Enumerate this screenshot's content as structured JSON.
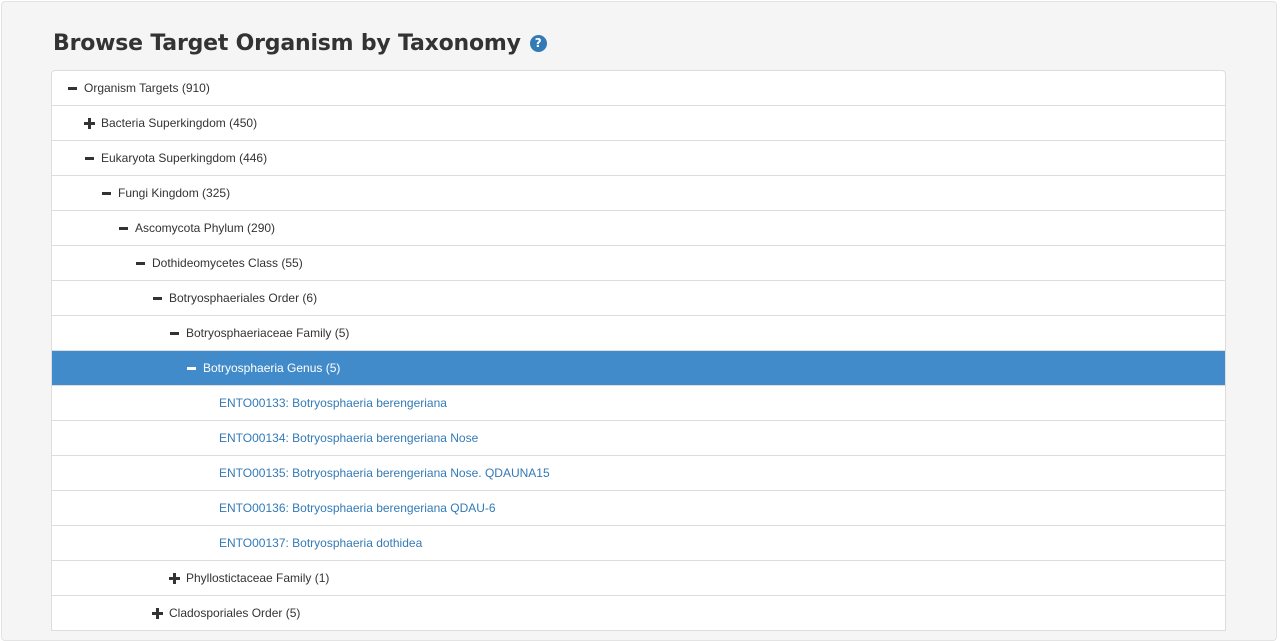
{
  "page": {
    "title": "Browse Target Organism by Taxonomy",
    "help_icon": "question-circle-icon"
  },
  "colors": {
    "selected_bg": "#428bca",
    "link": "#337ab7",
    "help_icon": "#337ab7"
  },
  "tree": {
    "rows": [
      {
        "label": "Organism Targets (910)",
        "toggle": "minus-icon"
      },
      {
        "label": "Bacteria Superkingdom (450)",
        "toggle": "plus-icon"
      },
      {
        "label": "Eukaryota Superkingdom (446)",
        "toggle": "minus-icon"
      },
      {
        "label": "Fungi Kingdom (325)",
        "toggle": "minus-icon"
      },
      {
        "label": "Ascomycota Phylum (290)",
        "toggle": "minus-icon"
      },
      {
        "label": "Dothideomycetes Class (55)",
        "toggle": "minus-icon"
      },
      {
        "label": "Botryosphaeriales Order (6)",
        "toggle": "minus-icon"
      },
      {
        "label": "Botryosphaeriaceae Family (5)",
        "toggle": "minus-icon"
      },
      {
        "label": "Botryosphaeria Genus (5)",
        "toggle": "minus-icon",
        "selected": true
      },
      {
        "label": "ENTO00133: Botryosphaeria berengeriana"
      },
      {
        "label": "ENTO00134: Botryosphaeria berengeriana Nose"
      },
      {
        "label": "ENTO00135: Botryosphaeria berengeriana Nose. QDAUNA15"
      },
      {
        "label": "ENTO00136: Botryosphaeria berengeriana QDAU-6"
      },
      {
        "label": "ENTO00137: Botryosphaeria dothidea"
      },
      {
        "label": "Phyllostictaceae Family (1)",
        "toggle": "plus-icon"
      },
      {
        "label": "Cladosporiales Order (5)",
        "toggle": "plus-icon"
      }
    ]
  }
}
